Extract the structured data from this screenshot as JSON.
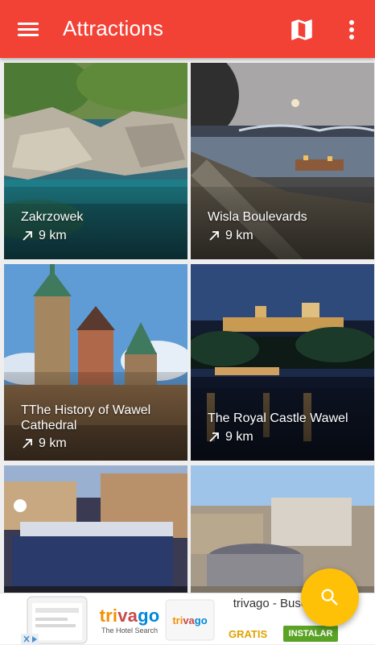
{
  "appbar": {
    "title": "Attractions",
    "color": "#f24236"
  },
  "attractions": [
    {
      "name": "Zakrzowek",
      "distance": "9 km"
    },
    {
      "name": "Wisla Boulevards",
      "distance": "9 km"
    },
    {
      "name": "TThe History of Wawel Cathedral",
      "distance": "9 km"
    },
    {
      "name": "The Royal Castle Wawel",
      "distance": "9 km"
    },
    {
      "name": "",
      "distance": ""
    },
    {
      "name": "",
      "distance": ""
    }
  ],
  "ad": {
    "brand": "trivago",
    "brand_tagline": "The Hotel Search",
    "headline": "trivago - Busca hoteles",
    "price_label": "GRATIS",
    "cta": "INSTALAR",
    "accent": "#5aa324"
  },
  "icons": {
    "menu": "menu-icon",
    "map": "map-icon",
    "more": "more-vert-icon",
    "distance": "arrow-up-right-icon",
    "search": "search-icon"
  },
  "fab_color": "#ffc107"
}
